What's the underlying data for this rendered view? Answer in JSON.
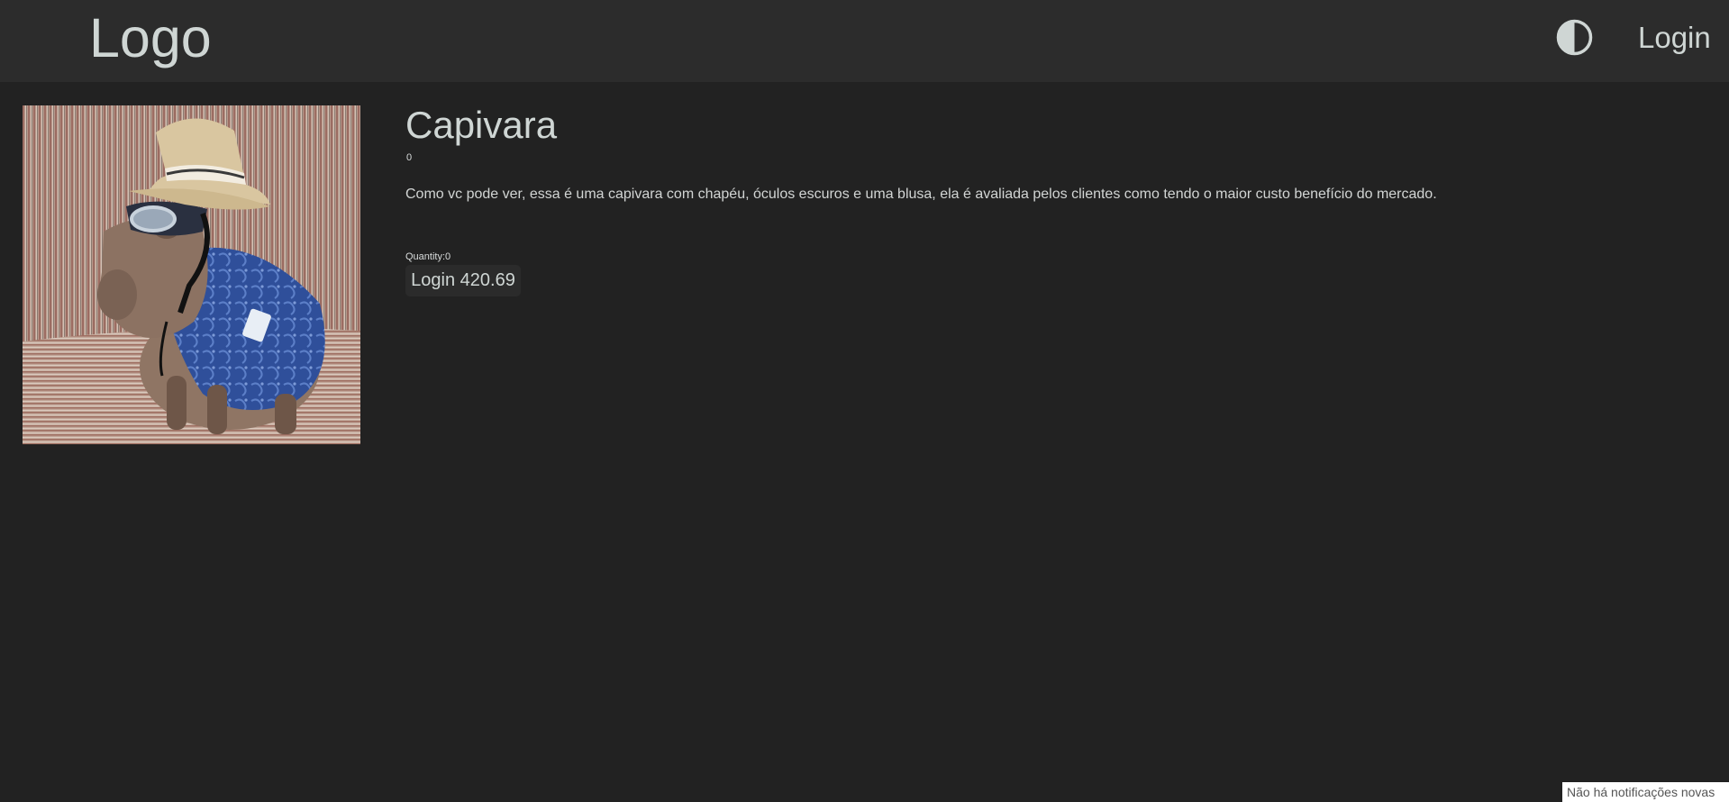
{
  "header": {
    "logo_text": "Logo",
    "theme_icon": "contrast-half-circle-icon",
    "login_label": "Login"
  },
  "product": {
    "image_alt": "capybara wearing straw hat, sunglasses and blue shirt",
    "title": "Capivara",
    "rating": "0",
    "description": "Como vc pode ver, essa é uma capivara com chapéu, óculos escuros e uma blusa, ela é avaliada pelos clientes como tendo o maior custo benefício do mercado.",
    "quantity_label": "Quantity:0",
    "buy_button_label": "Login 420.69"
  },
  "notification": {
    "text": "Não há notificações novas"
  },
  "colors": {
    "background": "#222222",
    "navbar": "#2c2c2c",
    "text": "#cfd6d4"
  }
}
